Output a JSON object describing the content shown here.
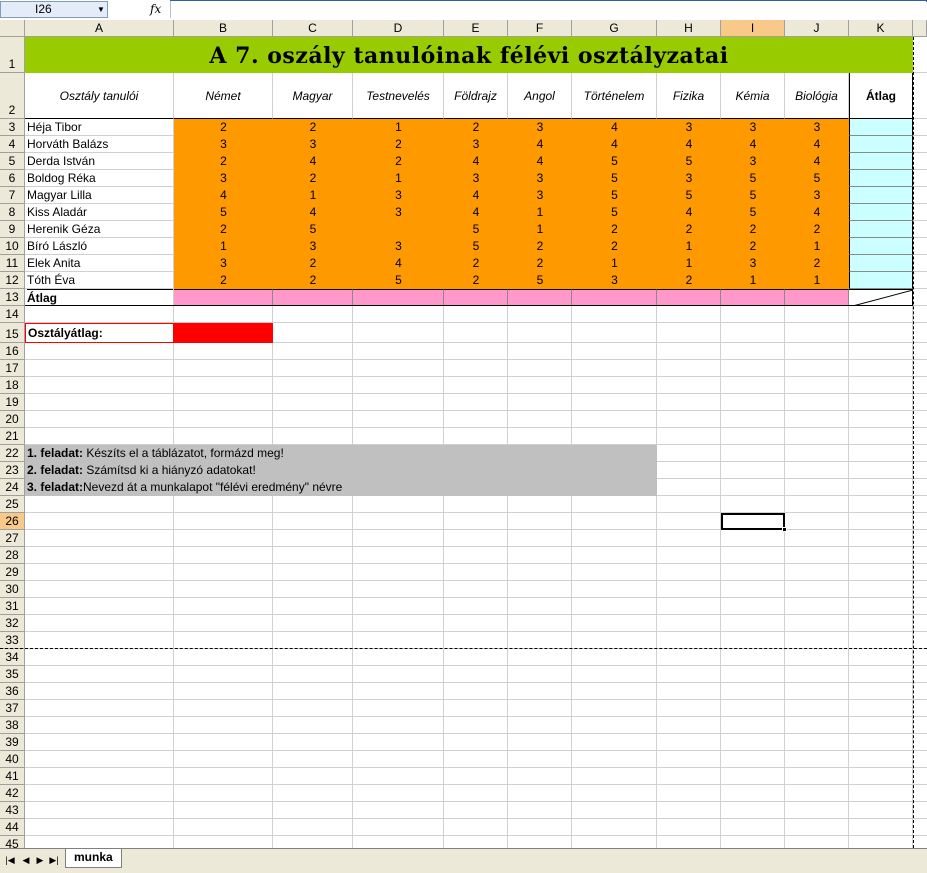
{
  "formula_bar": {
    "name_box": "I26",
    "fx": "fx"
  },
  "columns": [
    "A",
    "B",
    "C",
    "D",
    "E",
    "F",
    "G",
    "H",
    "I",
    "J",
    "K"
  ],
  "selected_column": "I",
  "selected_row": 26,
  "rows": [
    "1",
    "2",
    "3",
    "4",
    "5",
    "6",
    "7",
    "8",
    "9",
    "10",
    "11",
    "12",
    "13",
    "14",
    "15",
    "16",
    "17",
    "18",
    "19",
    "20",
    "21",
    "22",
    "23",
    "24",
    "25",
    "26",
    "27",
    "28",
    "29",
    "30",
    "31",
    "32",
    "33",
    "34",
    "35",
    "36",
    "37",
    "38",
    "39",
    "40",
    "41",
    "42",
    "43",
    "44",
    "45"
  ],
  "title": "A 7. oszály tanulóinak félévi osztályzatai",
  "headers": {
    "students": "Osztály tanulói",
    "subjects": [
      "Német",
      "Magyar",
      "Testnevelés",
      "Földrajz",
      "Angol",
      "Történelem",
      "Fizika",
      "Kémia",
      "Biológia"
    ],
    "average": "Átlag"
  },
  "students": [
    {
      "name": "Héja Tibor",
      "grades": [
        "2",
        "2",
        "1",
        "2",
        "3",
        "4",
        "3",
        "3",
        "3"
      ]
    },
    {
      "name": "Horváth Balázs",
      "grades": [
        "3",
        "3",
        "2",
        "3",
        "4",
        "4",
        "4",
        "4",
        "4"
      ]
    },
    {
      "name": "Derda István",
      "grades": [
        "2",
        "4",
        "2",
        "4",
        "4",
        "5",
        "5",
        "3",
        "4"
      ]
    },
    {
      "name": "Boldog Réka",
      "grades": [
        "3",
        "2",
        "1",
        "3",
        "3",
        "5",
        "3",
        "5",
        "5"
      ]
    },
    {
      "name": "Magyar Lilla",
      "grades": [
        "4",
        "1",
        "3",
        "4",
        "3",
        "5",
        "5",
        "5",
        "3"
      ]
    },
    {
      "name": "Kiss Aladár",
      "grades": [
        "5",
        "4",
        "3",
        "4",
        "1",
        "5",
        "4",
        "5",
        "4"
      ]
    },
    {
      "name": "Herenik Géza",
      "grades": [
        "2",
        "5",
        "",
        "5",
        "1",
        "2",
        "2",
        "2",
        "2"
      ]
    },
    {
      "name": "Bíró László",
      "grades": [
        "1",
        "3",
        "3",
        "5",
        "2",
        "2",
        "1",
        "2",
        "1"
      ]
    },
    {
      "name": "Elek Anita",
      "grades": [
        "3",
        "2",
        "4",
        "2",
        "2",
        "1",
        "1",
        "3",
        "2"
      ]
    },
    {
      "name": "Tóth Éva",
      "grades": [
        "2",
        "2",
        "5",
        "2",
        "5",
        "3",
        "2",
        "1",
        "1"
      ]
    }
  ],
  "average_row_label": "Átlag",
  "class_average_label": "Osztályátlag:",
  "tasks": [
    {
      "label": "1. feladat:",
      "text": " Készíts el a táblázatot, formázd meg!"
    },
    {
      "label": "2. feladat:",
      "text": " Számítsd ki a hiányzó adatokat!"
    },
    {
      "label": "3. feladat:",
      "text": "Nevezd át a munkalapot \"félévi eredmény\" névre"
    }
  ],
  "sheet_tab": "munka",
  "colors": {
    "title_bg": "#99cc00",
    "grades_bg": "#ff9900",
    "avg_row_bg": "#ff99cc",
    "avg_col_bg": "#ccffff",
    "class_avg_bg": "#ff0000",
    "tasks_bg": "#c0c0c0"
  }
}
